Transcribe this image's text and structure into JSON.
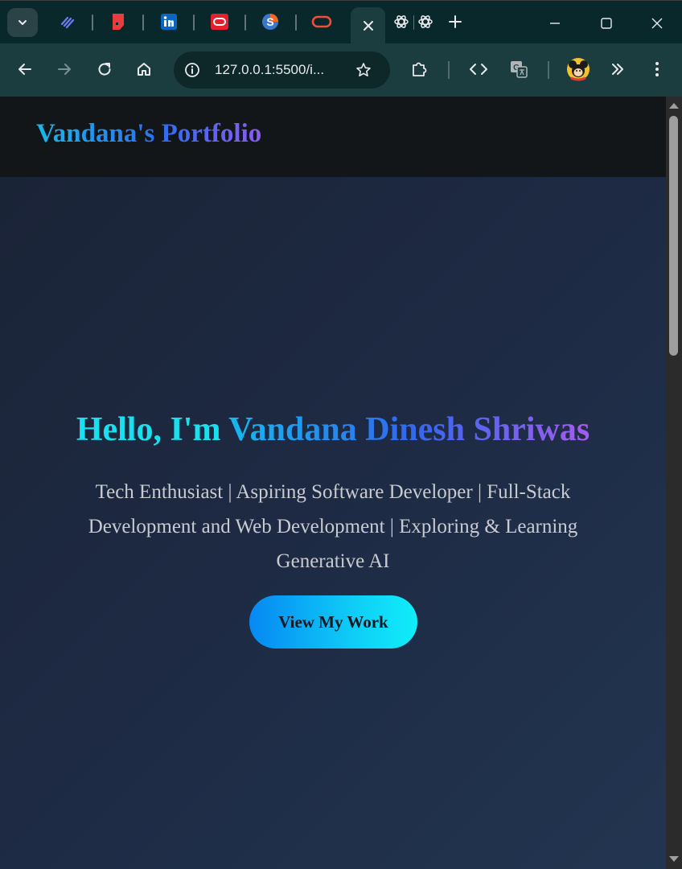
{
  "browser": {
    "tabs": [
      {
        "name": "tab-1",
        "icon": "stripes-logo-icon"
      },
      {
        "name": "tab-2",
        "icon": "red-bookmark-icon"
      },
      {
        "name": "tab-3",
        "icon": "linkedin-icon"
      },
      {
        "name": "tab-4",
        "icon": "oracle-icon"
      },
      {
        "name": "tab-5",
        "icon": "s-logo-icon"
      },
      {
        "name": "tab-6-active",
        "icon": "oracle-outline-icon"
      },
      {
        "name": "tab-7",
        "icon": "chatgpt-icon"
      },
      {
        "name": "tab-8",
        "icon": "chatgpt-icon"
      }
    ],
    "address": "127.0.0.1:5500/i..."
  },
  "site": {
    "logo": "Vandana's Portfolio",
    "hero": {
      "greeting": "Hello, I'm ",
      "name": "Vandana Dinesh Shriwas",
      "subtitle": "Tech Enthusiast | Aspiring Software Developer | Full-Stack Development and Web Development | Exploring & Learning Generative AI",
      "cta": "View My Work"
    }
  },
  "colors": {
    "tab_strip": "#09282b",
    "toolbar": "#1c3d40",
    "greeting": "#19e0ee",
    "cta_start": "#0688f3",
    "cta_end": "#10edf8"
  }
}
